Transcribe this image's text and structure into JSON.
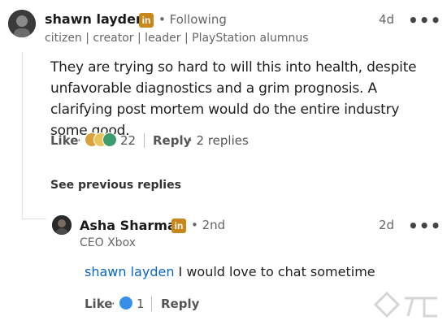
{
  "post": {
    "author": "shawn layden",
    "badge": "in",
    "connection": "• Following",
    "headline": "citizen | creator | leader | PlayStation alumnus",
    "time": "4d",
    "more": "•••",
    "text": "They are trying so hard to will this into health, despite unfavorable diagnostics and a grim prognosis. A clarifying post mortem would do the entire industry some good.",
    "like_label": "Like",
    "dot": "·",
    "reaction_count": "22",
    "reply_label": "Reply",
    "replies_count": "· 2 replies"
  },
  "see_previous": "See previous replies",
  "reply": {
    "author": "Asha Sharma",
    "badge": "in",
    "connection": "• 2nd",
    "headline": "CEO Xbox",
    "time": "2d",
    "more": "•••",
    "mention": "shawn layden",
    "text": " I would love to chat sometime",
    "like_label": "Like",
    "dot": "·",
    "reaction_count": "1",
    "reply_label": "Reply"
  },
  "colors": {
    "mention": "#0a66c2",
    "badge": "#c9861a",
    "thread_line": "#e0e0e0"
  }
}
